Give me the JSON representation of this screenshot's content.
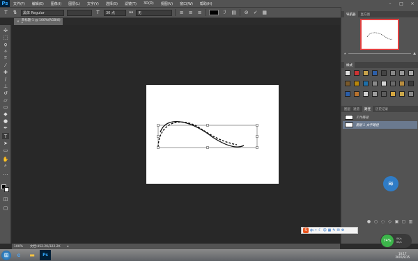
{
  "app": {
    "logo": "Ps"
  },
  "menu": [
    "文件(F)",
    "编辑(E)",
    "图像(I)",
    "图层(L)",
    "文字(Y)",
    "选择(S)",
    "滤镜(T)",
    "3D(D)",
    "视图(V)",
    "窗口(W)",
    "帮助(H)"
  ],
  "window_controls": {
    "minimize": "–",
    "maximize": "□",
    "close": "×"
  },
  "options": {
    "font_family": "黑体 Regular",
    "font_size": "30 点",
    "aa_label": "aa",
    "aa_mode": "无"
  },
  "document_tab": {
    "title": "未标题-1 @ 100%(RGB/8) *",
    "close": "×"
  },
  "panels": {
    "navigator_tabs": [
      "导航器",
      "直方图"
    ],
    "swatches_tab": "样式",
    "layers_tabs": [
      "图层",
      "通道",
      "路径",
      "历史记录"
    ],
    "paths": [
      {
        "name": "工作路径",
        "selected": false
      },
      {
        "name": "图层 1 文字路径",
        "selected": true
      }
    ]
  },
  "status": {
    "zoom": "100%",
    "doc_info": "文档:452.2K/322.2K"
  },
  "taskbar": {
    "time": "10:17",
    "date": "2015/5/15"
  },
  "ime": {
    "label": "中"
  },
  "speed": {
    "percent": "74%",
    "up": "0K/s",
    "down": "0K/s"
  },
  "colors": {
    "panel_bg": "#535353",
    "workspace": "#282828",
    "selected_row": "#6b7a8f",
    "accent_red": "#e04040"
  }
}
